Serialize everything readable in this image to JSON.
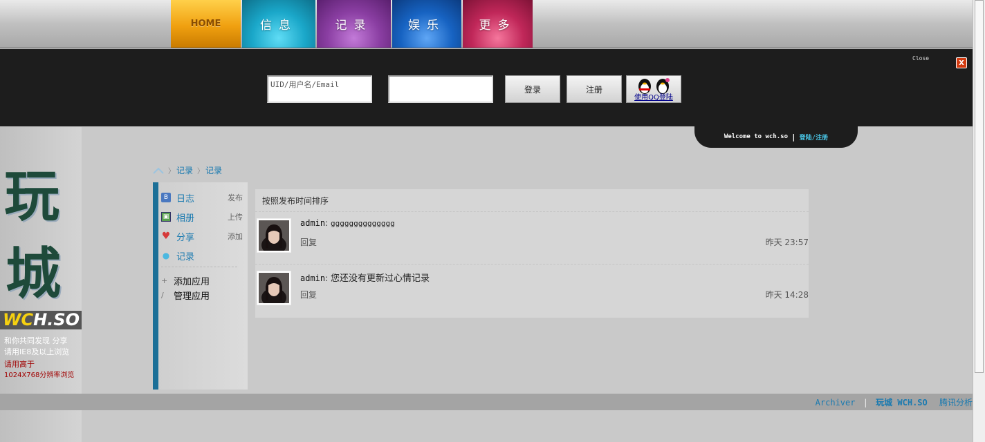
{
  "nav": {
    "tabs": [
      {
        "label": "HOME",
        "color": "#f0a010"
      },
      {
        "label": "信息",
        "color": "#1aa7c9"
      },
      {
        "label": "记录",
        "color": "#8a3ea2"
      },
      {
        "label": "娱乐",
        "color": "#1763c2"
      },
      {
        "label": "更多",
        "color": "#c02759"
      }
    ]
  },
  "login": {
    "username_placeholder": "UID/用户名/Email",
    "password_value": "",
    "login_button": "登录",
    "register_button": "注册",
    "qq_login_label": "使用QQ登陆",
    "close_label": "Close",
    "close_icon_glyph": "X"
  },
  "welcome": {
    "text": "Welcome to wch.so",
    "separator": "|",
    "link": "登陆/注册"
  },
  "logo": {
    "char1": "玩",
    "char2": "城",
    "wordmark_w": "W",
    "wordmark_c": "C",
    "wordmark_rest": "H.SO",
    "tagline1": "和你共同发现 分享",
    "tagline2": "请用IE8及以上浏览",
    "notice1": "请用高于",
    "notice2": "1024X768分辨率浏览"
  },
  "breadcrumb": {
    "sep": "〉",
    "item1": "记录",
    "item2": "记录"
  },
  "sidebar": {
    "items": [
      {
        "label": "日志",
        "action": "发布",
        "icon": "blog-icon",
        "icon_color": "#4a78c0",
        "icon_glyph": "B"
      },
      {
        "label": "相册",
        "action": "上传",
        "icon": "album-icon",
        "icon_color": "#5aa050",
        "icon_glyph": "▣"
      },
      {
        "label": "分享",
        "action": "添加",
        "icon": "share-icon",
        "icon_color": "#d63a3a",
        "icon_glyph": "♥"
      },
      {
        "label": "记录",
        "action": "",
        "icon": "chat-bubble-icon",
        "icon_color": "#4bb8e0",
        "icon_glyph": "●"
      }
    ],
    "add_app": "添加应用",
    "manage_app": "管理应用"
  },
  "main": {
    "sort_label": "按照发布时间排序",
    "entries": [
      {
        "user": "admin",
        "colon": ":",
        "content": "gggggggggggggg",
        "reply": "回复",
        "time": "昨天 23:57"
      },
      {
        "user": "admin",
        "colon": ":",
        "content": "您还没有更新过心情记录",
        "reply": "回复",
        "time": "昨天 14:28"
      }
    ]
  },
  "footer": {
    "archiver": "Archiver",
    "sep": "|",
    "site": "玩城 WCH.SO",
    "analytics": "腾讯分析"
  }
}
